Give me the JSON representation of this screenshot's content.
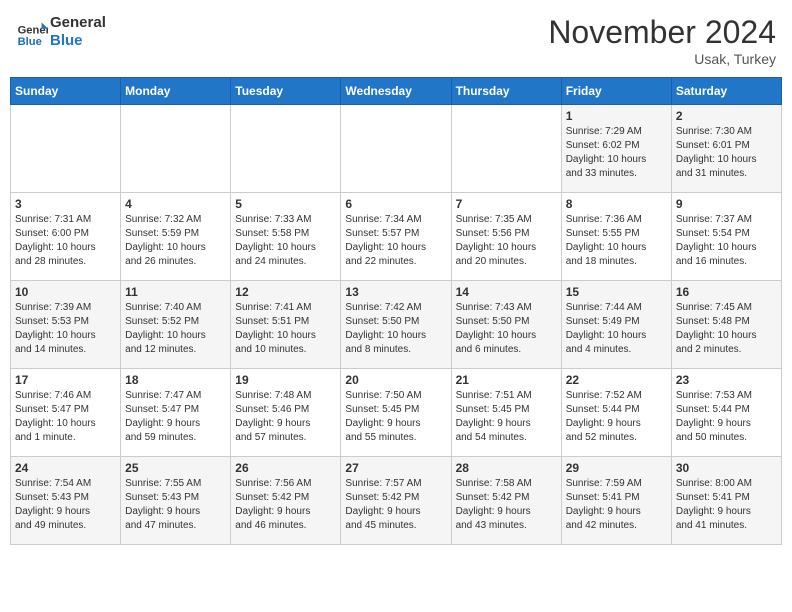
{
  "header": {
    "logo_line1": "General",
    "logo_line2": "Blue",
    "month": "November 2024",
    "location": "Usak, Turkey"
  },
  "days_of_week": [
    "Sunday",
    "Monday",
    "Tuesday",
    "Wednesday",
    "Thursday",
    "Friday",
    "Saturday"
  ],
  "weeks": [
    [
      {
        "day": "",
        "info": ""
      },
      {
        "day": "",
        "info": ""
      },
      {
        "day": "",
        "info": ""
      },
      {
        "day": "",
        "info": ""
      },
      {
        "day": "",
        "info": ""
      },
      {
        "day": "1",
        "info": "Sunrise: 7:29 AM\nSunset: 6:02 PM\nDaylight: 10 hours\nand 33 minutes."
      },
      {
        "day": "2",
        "info": "Sunrise: 7:30 AM\nSunset: 6:01 PM\nDaylight: 10 hours\nand 31 minutes."
      }
    ],
    [
      {
        "day": "3",
        "info": "Sunrise: 7:31 AM\nSunset: 6:00 PM\nDaylight: 10 hours\nand 28 minutes."
      },
      {
        "day": "4",
        "info": "Sunrise: 7:32 AM\nSunset: 5:59 PM\nDaylight: 10 hours\nand 26 minutes."
      },
      {
        "day": "5",
        "info": "Sunrise: 7:33 AM\nSunset: 5:58 PM\nDaylight: 10 hours\nand 24 minutes."
      },
      {
        "day": "6",
        "info": "Sunrise: 7:34 AM\nSunset: 5:57 PM\nDaylight: 10 hours\nand 22 minutes."
      },
      {
        "day": "7",
        "info": "Sunrise: 7:35 AM\nSunset: 5:56 PM\nDaylight: 10 hours\nand 20 minutes."
      },
      {
        "day": "8",
        "info": "Sunrise: 7:36 AM\nSunset: 5:55 PM\nDaylight: 10 hours\nand 18 minutes."
      },
      {
        "day": "9",
        "info": "Sunrise: 7:37 AM\nSunset: 5:54 PM\nDaylight: 10 hours\nand 16 minutes."
      }
    ],
    [
      {
        "day": "10",
        "info": "Sunrise: 7:39 AM\nSunset: 5:53 PM\nDaylight: 10 hours\nand 14 minutes."
      },
      {
        "day": "11",
        "info": "Sunrise: 7:40 AM\nSunset: 5:52 PM\nDaylight: 10 hours\nand 12 minutes."
      },
      {
        "day": "12",
        "info": "Sunrise: 7:41 AM\nSunset: 5:51 PM\nDaylight: 10 hours\nand 10 minutes."
      },
      {
        "day": "13",
        "info": "Sunrise: 7:42 AM\nSunset: 5:50 PM\nDaylight: 10 hours\nand 8 minutes."
      },
      {
        "day": "14",
        "info": "Sunrise: 7:43 AM\nSunset: 5:50 PM\nDaylight: 10 hours\nand 6 minutes."
      },
      {
        "day": "15",
        "info": "Sunrise: 7:44 AM\nSunset: 5:49 PM\nDaylight: 10 hours\nand 4 minutes."
      },
      {
        "day": "16",
        "info": "Sunrise: 7:45 AM\nSunset: 5:48 PM\nDaylight: 10 hours\nand 2 minutes."
      }
    ],
    [
      {
        "day": "17",
        "info": "Sunrise: 7:46 AM\nSunset: 5:47 PM\nDaylight: 10 hours\nand 1 minute."
      },
      {
        "day": "18",
        "info": "Sunrise: 7:47 AM\nSunset: 5:47 PM\nDaylight: 9 hours\nand 59 minutes."
      },
      {
        "day": "19",
        "info": "Sunrise: 7:48 AM\nSunset: 5:46 PM\nDaylight: 9 hours\nand 57 minutes."
      },
      {
        "day": "20",
        "info": "Sunrise: 7:50 AM\nSunset: 5:45 PM\nDaylight: 9 hours\nand 55 minutes."
      },
      {
        "day": "21",
        "info": "Sunrise: 7:51 AM\nSunset: 5:45 PM\nDaylight: 9 hours\nand 54 minutes."
      },
      {
        "day": "22",
        "info": "Sunrise: 7:52 AM\nSunset: 5:44 PM\nDaylight: 9 hours\nand 52 minutes."
      },
      {
        "day": "23",
        "info": "Sunrise: 7:53 AM\nSunset: 5:44 PM\nDaylight: 9 hours\nand 50 minutes."
      }
    ],
    [
      {
        "day": "24",
        "info": "Sunrise: 7:54 AM\nSunset: 5:43 PM\nDaylight: 9 hours\nand 49 minutes."
      },
      {
        "day": "25",
        "info": "Sunrise: 7:55 AM\nSunset: 5:43 PM\nDaylight: 9 hours\nand 47 minutes."
      },
      {
        "day": "26",
        "info": "Sunrise: 7:56 AM\nSunset: 5:42 PM\nDaylight: 9 hours\nand 46 minutes."
      },
      {
        "day": "27",
        "info": "Sunrise: 7:57 AM\nSunset: 5:42 PM\nDaylight: 9 hours\nand 45 minutes."
      },
      {
        "day": "28",
        "info": "Sunrise: 7:58 AM\nSunset: 5:42 PM\nDaylight: 9 hours\nand 43 minutes."
      },
      {
        "day": "29",
        "info": "Sunrise: 7:59 AM\nSunset: 5:41 PM\nDaylight: 9 hours\nand 42 minutes."
      },
      {
        "day": "30",
        "info": "Sunrise: 8:00 AM\nSunset: 5:41 PM\nDaylight: 9 hours\nand 41 minutes."
      }
    ]
  ]
}
